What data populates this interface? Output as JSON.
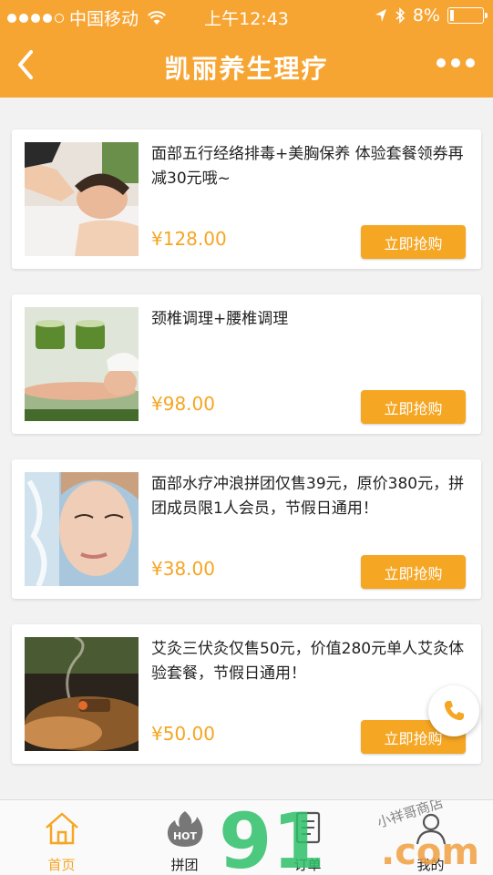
{
  "status_bar": {
    "carrier": "中国移动",
    "time": "上午12:43",
    "battery": "8%"
  },
  "header": {
    "title": "凯丽养生理疗"
  },
  "products": [
    {
      "title": "面部五行经络排毒+美胸保养 体验套餐领券再减30元哦~",
      "price": "¥128.00",
      "button": "立即抢购"
    },
    {
      "title": "颈椎调理+腰椎调理",
      "price": "¥98.00",
      "button": "立即抢购"
    },
    {
      "title": "面部水疗冲浪拼团仅售39元，原价380元，拼团成员限1人会员，节假日通用！",
      "price": "¥38.00",
      "button": "立即抢购"
    },
    {
      "title": "艾灸三伏灸仅售50元，价值280元单人艾灸体验套餐，节假日通用！",
      "price": "¥50.00",
      "button": "立即抢购"
    }
  ],
  "tabs": [
    {
      "label": "首页",
      "icon": "home-icon",
      "active": true
    },
    {
      "label": "拼团",
      "icon": "hot-flame-icon",
      "badge": "HOT"
    },
    {
      "label": "订单",
      "icon": "order-list-icon"
    },
    {
      "label": "我的",
      "icon": "user-icon"
    }
  ],
  "watermark": {
    "brand": "91",
    "domain": ".com",
    "text": "小祥哥商店"
  },
  "colors": {
    "accent": "#f7a532",
    "button": "#f5a623"
  }
}
